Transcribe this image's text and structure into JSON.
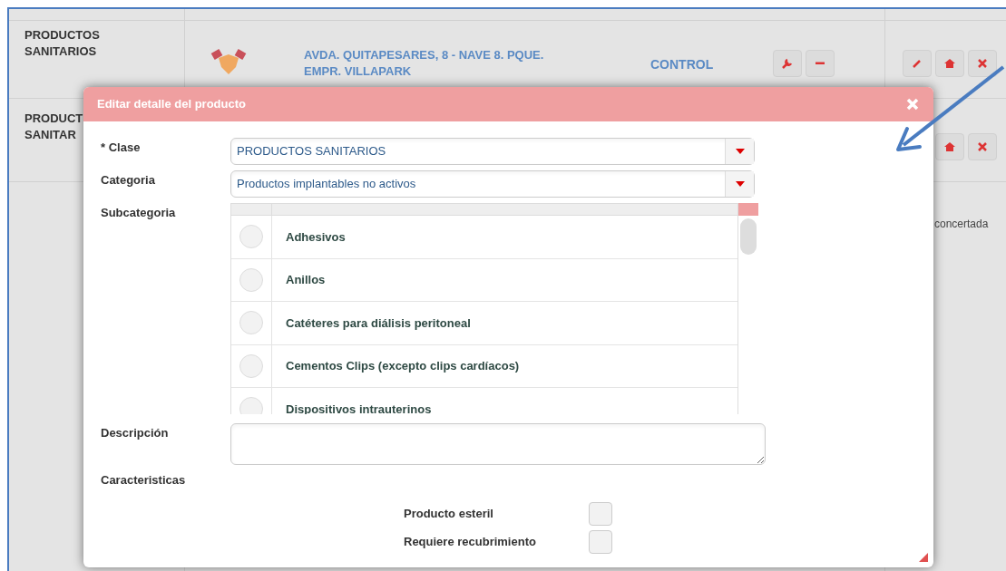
{
  "background_table": {
    "rows": [
      {
        "product": [
          "PRODUCTOS",
          "SANITARIOS"
        ],
        "address": [
          "AVDA. QUITAPESARES, 8 - NAVE 8. PQUE.",
          "EMPR. VILLAPARK"
        ],
        "type": "CONTROL"
      },
      {
        "product": [
          "PRODUCT",
          "SANITAR"
        ]
      }
    ],
    "side_note": "concertada"
  },
  "dialog": {
    "title": "Editar detalle del producto",
    "fields": [
      {
        "label": "* Clase",
        "kind": "select",
        "value": "PRODUCTOS SANITARIOS"
      },
      {
        "label": "Categoria",
        "kind": "select",
        "value": "Productos implantables no activos"
      },
      {
        "label": "Subcategoria",
        "kind": "list",
        "options": [
          {
            "label": "Adhesivos",
            "selected": false
          },
          {
            "label": "Anillos",
            "selected": false
          },
          {
            "label": "Catéteres para diálisis peritoneal",
            "selected": false
          },
          {
            "label": "Cementos Clips (excepto clips cardíacos)",
            "selected": false
          },
          {
            "label": "Dispositivos intrauterinos",
            "selected": false
          }
        ]
      },
      {
        "label": "Descripción",
        "kind": "textarea"
      },
      {
        "label": "Caracteristicas",
        "kind": "checks",
        "options": [
          {
            "label": "Producto esteril",
            "checked": false
          },
          {
            "label": "Requiere recubrimiento",
            "checked": false
          }
        ]
      }
    ]
  }
}
